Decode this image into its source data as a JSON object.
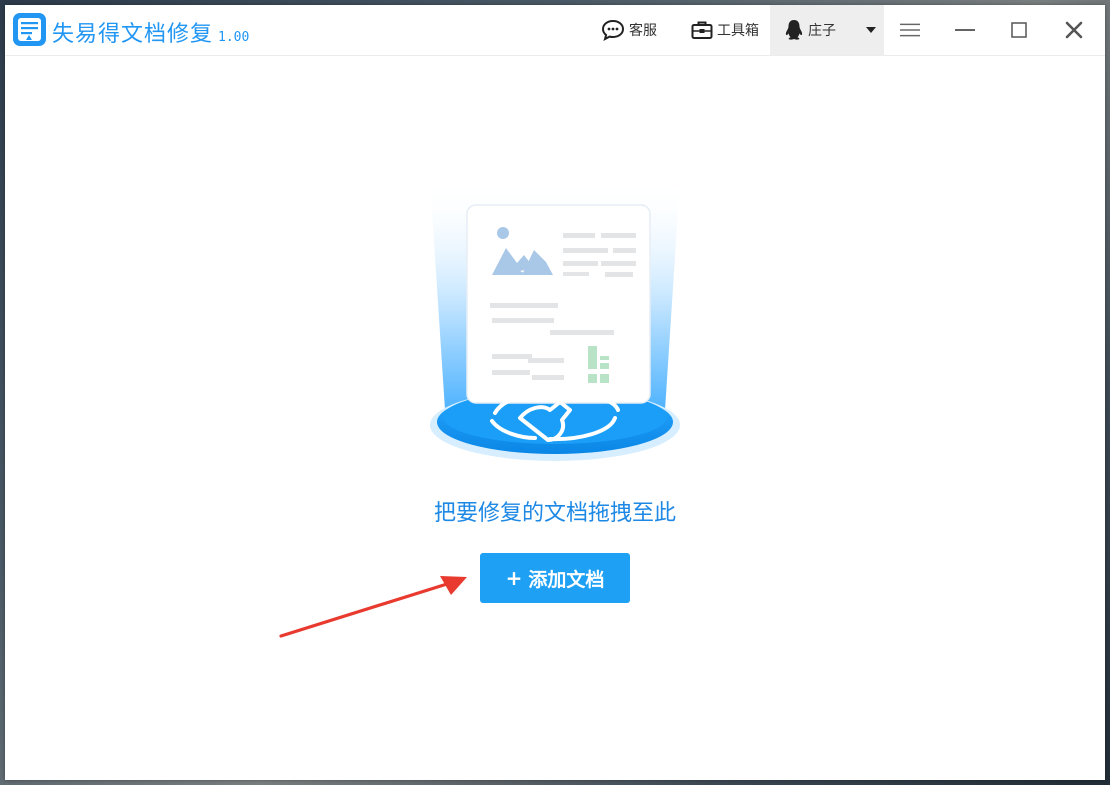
{
  "app": {
    "title": "失易得文档修复",
    "version": "1.00",
    "brand_color": "#2196f3"
  },
  "toolbar": {
    "service_label": "客服",
    "service_icon": "chat-bubble-icon",
    "tools_label": "工具箱",
    "tools_icon": "toolbox-icon",
    "user_name": "庄子",
    "user_icon": "qq-penguin-icon",
    "menu_icon": "hamburger-menu-icon",
    "minimize_icon": "minimize-icon",
    "maximize_icon": "maximize-icon",
    "close_icon": "close-icon"
  },
  "main": {
    "drop_hint": "把要修复的文档拖拽至此",
    "add_button_plus": "+",
    "add_button_label": "添加文档",
    "button_color": "#1ea0f5",
    "illustration_icon": "document-repair-illustration"
  }
}
